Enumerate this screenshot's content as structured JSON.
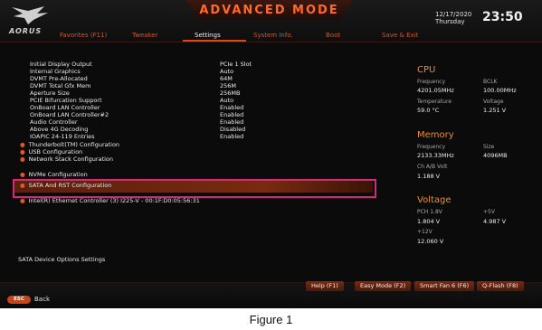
{
  "header": {
    "logo_text": "AORUS",
    "mode_title": "ADVANCED MODE",
    "date": "12/17/2020",
    "day": "Thursday",
    "time": "23:50"
  },
  "tabs": [
    {
      "label": "Favorites (F11)"
    },
    {
      "label": "Tweaker"
    },
    {
      "label": "Settings"
    },
    {
      "label": "System Info."
    },
    {
      "label": "Boot"
    },
    {
      "label": "Save & Exit"
    }
  ],
  "active_tab": "Settings",
  "settings": [
    {
      "label": "Initial Display Output",
      "value": "PCIe 1 Slot"
    },
    {
      "label": "Internal Graphics",
      "value": "Auto"
    },
    {
      "label": "DVMT Pre-Allocated",
      "value": "64M"
    },
    {
      "label": "DVMT Total Gfx Mem",
      "value": "256M"
    },
    {
      "label": "Aperture Size",
      "value": "256MB"
    },
    {
      "label": "PCIE Bifurcation Support",
      "value": "Auto"
    },
    {
      "label": "OnBoard LAN Controller",
      "value": "Enabled"
    },
    {
      "label": "OnBoard LAN Controller#2",
      "value": "Enabled"
    },
    {
      "label": "Audio Controller",
      "value": "Enabled"
    },
    {
      "label": "Above 4G Decoding",
      "value": "Disabled"
    },
    {
      "label": "IOAPIC 24-119 Entries",
      "value": "Enabled"
    }
  ],
  "submenus": [
    {
      "label": "Thunderbolt(TM) Configuration"
    },
    {
      "label": "USB Configuration"
    },
    {
      "label": "Network Stack Configuration"
    },
    {
      "label": "NVMe Configuration"
    },
    {
      "label": "SATA And RST Configuration"
    },
    {
      "label": "Intel(R) Ethernet Controller (3) I225-V - 00:1F:D0:05:56:31"
    }
  ],
  "help_text": "SATA Device Options Settings",
  "cpu": {
    "title": "CPU",
    "frequency_label": "Frequency",
    "frequency": "4201.05MHz",
    "bclk_label": "BCLK",
    "bclk": "100.00MHz",
    "temperature_label": "Temperature",
    "temperature": "59.0 °C",
    "voltage_label": "Voltage",
    "voltage": "1.251 V"
  },
  "memory": {
    "title": "Memory",
    "frequency_label": "Frequency",
    "frequency": "2133.33MHz",
    "size_label": "Size",
    "size": "4096MB",
    "chab_label": "Ch A/B Volt",
    "chab": "1.188 V"
  },
  "voltage": {
    "title": "Voltage",
    "pch_label": "PCH 1.8V",
    "pch": "1.804 V",
    "p5_label": "+5V",
    "p5": "4.987 V",
    "p12_label": "+12V",
    "p12": "12.060 V"
  },
  "function_buttons": [
    {
      "label": "Help (F1)"
    },
    {
      "label": "Easy Mode (F2)"
    },
    {
      "label": "Smart Fan 6 (F6)"
    },
    {
      "label": "Q-Flash (F8)"
    }
  ],
  "esc_label": "ESC",
  "back_label": "Back",
  "caption": "Figure 1",
  "colors": {
    "accent": "#e05a20",
    "highlight_border": "#d12a7c",
    "section_title": "#f08c2c"
  }
}
